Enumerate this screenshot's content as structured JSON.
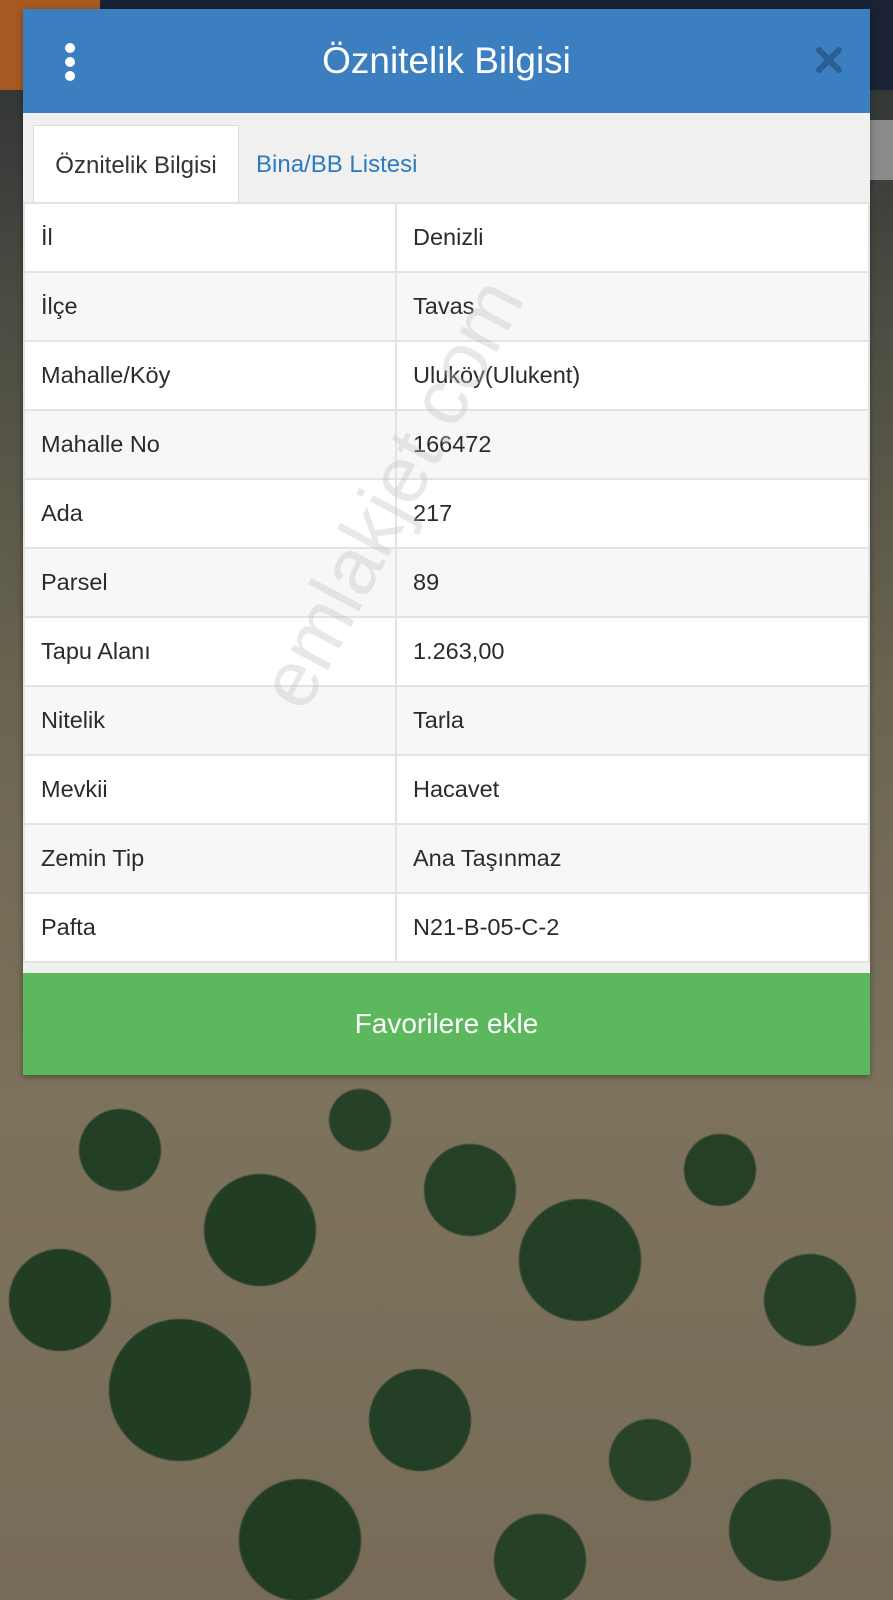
{
  "header": {
    "title": "Öznitelik Bilgisi",
    "menu_icon": "vertical-dots-icon",
    "close_icon": "close-x-icon",
    "color": "#3b7fc0"
  },
  "tabs": [
    {
      "label": "Öznitelik Bilgisi",
      "active": true
    },
    {
      "label": "Bina/BB Listesi",
      "active": false
    }
  ],
  "attributes": [
    {
      "key": "İl",
      "value": "Denizli"
    },
    {
      "key": "İlçe",
      "value": "Tavas"
    },
    {
      "key": "Mahalle/Köy",
      "value": "Uluköy(Ulukent)"
    },
    {
      "key": "Mahalle No",
      "value": "166472"
    },
    {
      "key": "Ada",
      "value": "217"
    },
    {
      "key": "Parsel",
      "value": "89"
    },
    {
      "key": "Tapu Alanı",
      "value": "1.263,00"
    },
    {
      "key": "Nitelik",
      "value": "Tarla"
    },
    {
      "key": "Mevkii",
      "value": "Hacavet"
    },
    {
      "key": "Zemin Tip",
      "value": "Ana Taşınmaz"
    },
    {
      "key": "Pafta",
      "value": "N21-B-05-C-2"
    }
  ],
  "footer": {
    "favorite_label": "Favorilere ekle",
    "color": "#5cb85c"
  },
  "watermark": "emlakjet.com"
}
